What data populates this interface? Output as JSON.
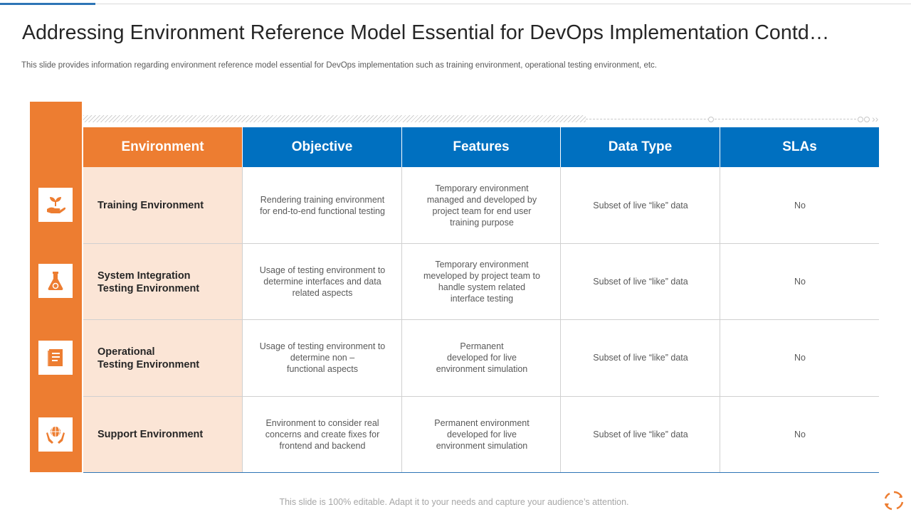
{
  "title": "Addressing Environment Reference Model Essential for DevOps Implementation Contd…",
  "subtitle": "This slide provides information regarding environment reference model essential for DevOps implementation such as training environment, operational testing environment, etc.",
  "table": {
    "headers": [
      "Environment",
      "Objective",
      "Features",
      "Data Type",
      "SLAs"
    ],
    "rows": [
      {
        "icon": "plant-in-hand-icon",
        "environment": "Training Environment",
        "objective": "Rendering training environment\nfor end-to-end functional testing",
        "features": "Temporary environment\nmanaged and developed by\nproject team for end user\ntraining purpose",
        "data_type": "Subset of live “like” data",
        "slas": "No"
      },
      {
        "icon": "lab-flask-icon",
        "environment": "System Integration\nTesting Environment",
        "objective": "Usage of testing environment to\ndetermine interfaces and data\nrelated aspects",
        "features": "Temporary environment\nmeveloped by project team to\nhandle system related\ninterface testing",
        "data_type": "Subset of live “like” data",
        "slas": "No"
      },
      {
        "icon": "document-book-icon",
        "environment": "Operational\nTesting Environment",
        "objective": "Usage of testing environment to\ndetermine non –\nfunctional aspects",
        "features": "Permanent\ndeveloped for live\nenvironment simulation",
        "data_type": "Subset of live “like” data",
        "slas": "No"
      },
      {
        "icon": "globe-in-hands-icon",
        "environment": "Support Environment",
        "objective": "Environment to consider real\nconcerns and create fixes for\nfrontend and backend",
        "features": "Permanent environment\ndeveloped for live\nenvironment simulation",
        "data_type": "Subset of live “like” data",
        "slas": "No"
      }
    ]
  },
  "footer": "This slide is 100% editable. Adapt it to your needs and capture your audience’s attention.",
  "corner_icon": "cycle-arrows-icon",
  "colors": {
    "accent_orange": "#ed7d31",
    "header_blue": "#0070c0",
    "env_cell_fill": "#fbe5d6"
  }
}
